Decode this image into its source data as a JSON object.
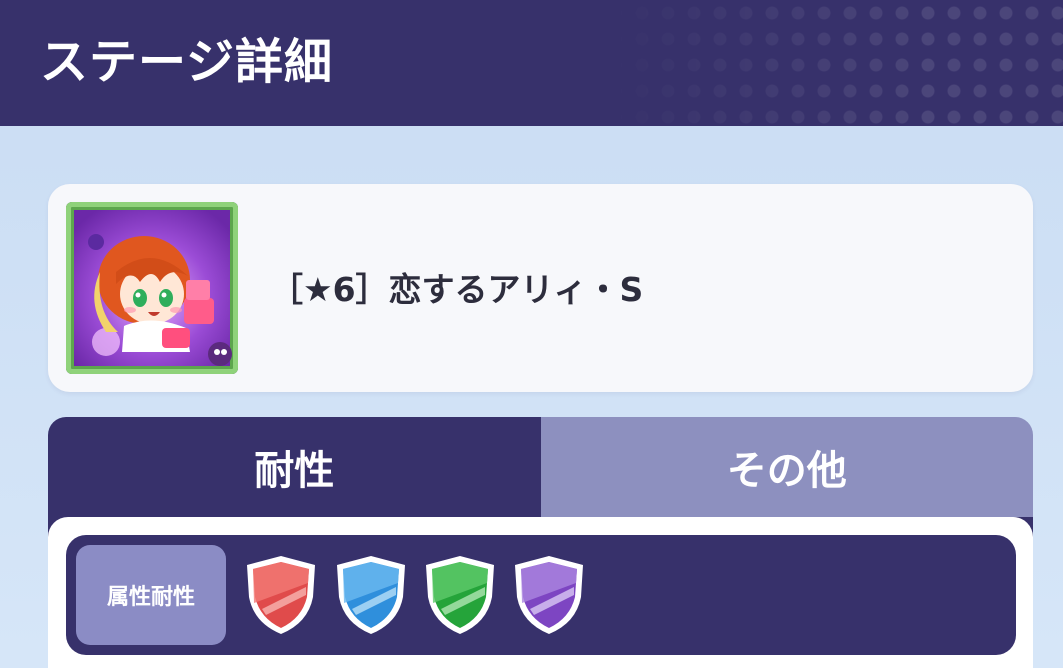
{
  "header": {
    "title": "ステージ詳細"
  },
  "stage": {
    "name": "［★6］恋するアリィ・S",
    "icon": "character-portrait-icon"
  },
  "tabs": [
    {
      "label": "耐性",
      "active": true
    },
    {
      "label": "その他",
      "active": false
    }
  ],
  "resistance": {
    "label": "属性耐性",
    "shields": [
      {
        "icon": "red-shield-icon",
        "color": "#e04b4b"
      },
      {
        "icon": "blue-shield-icon",
        "color": "#3b9ae0"
      },
      {
        "icon": "green-shield-icon",
        "color": "#2fae3c"
      },
      {
        "icon": "purple-shield-icon",
        "color": "#8b55c8"
      }
    ]
  },
  "colors": {
    "header_bg": "#37316b",
    "tab_active": "#37316b",
    "tab_inactive": "#8d90bf",
    "page_bg": "#cfe0f5"
  }
}
